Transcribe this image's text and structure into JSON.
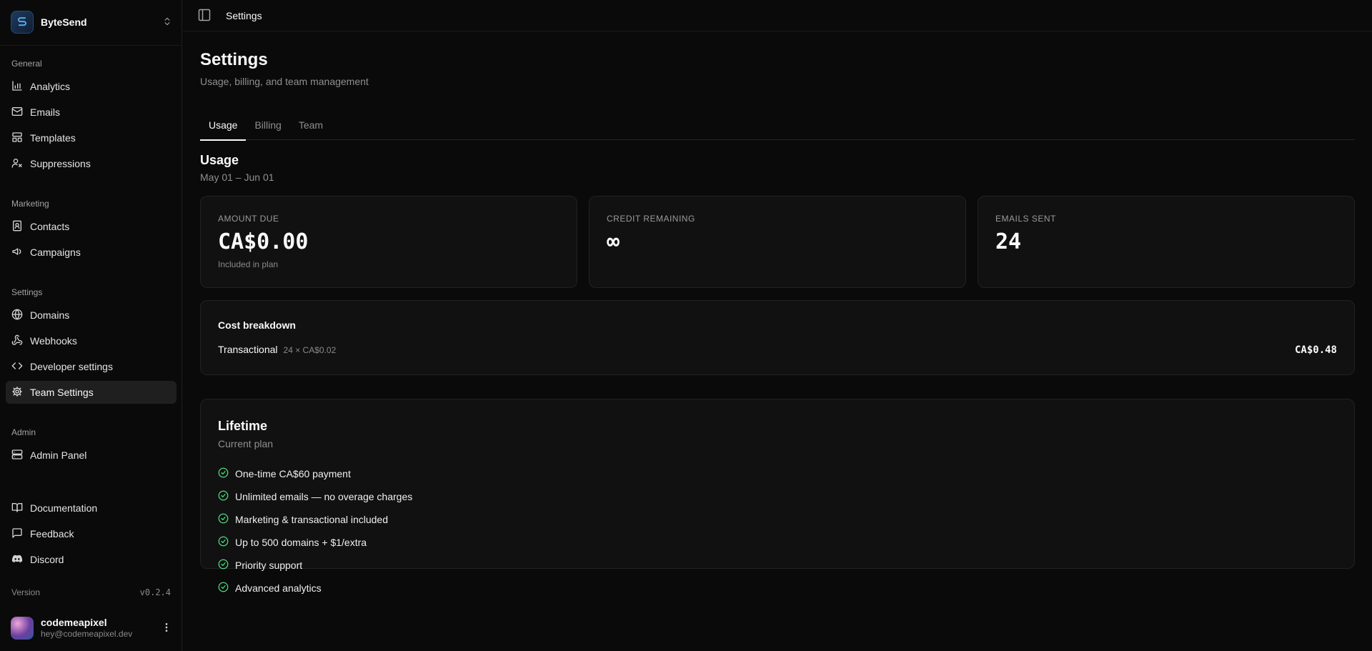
{
  "app": {
    "name": "ByteSend"
  },
  "sidebar": {
    "groups": [
      {
        "label": "General",
        "items": [
          {
            "label": "Analytics",
            "icon": "bar-chart-icon"
          },
          {
            "label": "Emails",
            "icon": "mail-icon"
          },
          {
            "label": "Templates",
            "icon": "layout-icon"
          },
          {
            "label": "Suppressions",
            "icon": "user-x-icon"
          }
        ]
      },
      {
        "label": "Marketing",
        "items": [
          {
            "label": "Contacts",
            "icon": "contact-book-icon"
          },
          {
            "label": "Campaigns",
            "icon": "megaphone-icon"
          }
        ]
      },
      {
        "label": "Settings",
        "items": [
          {
            "label": "Domains",
            "icon": "globe-icon"
          },
          {
            "label": "Webhooks",
            "icon": "webhook-icon"
          },
          {
            "label": "Developer settings",
            "icon": "code-icon"
          },
          {
            "label": "Team Settings",
            "icon": "gear-icon",
            "active": true
          }
        ]
      },
      {
        "label": "Admin",
        "items": [
          {
            "label": "Admin Panel",
            "icon": "server-icon"
          }
        ]
      }
    ],
    "footer_links": [
      {
        "label": "Documentation",
        "icon": "book-icon"
      },
      {
        "label": "Feedback",
        "icon": "message-icon"
      },
      {
        "label": "Discord",
        "icon": "discord-icon"
      }
    ],
    "version_label": "Version",
    "version_value": "v0.2.4",
    "user": {
      "name": "codemeapixel",
      "email": "hey@codemeapixel.dev"
    }
  },
  "topbar": {
    "breadcrumb": "Settings"
  },
  "page": {
    "title": "Settings",
    "subtitle": "Usage, billing, and team management",
    "tabs": [
      {
        "label": "Usage",
        "active": true
      },
      {
        "label": "Billing",
        "active": false
      },
      {
        "label": "Team",
        "active": false
      }
    ]
  },
  "usage": {
    "title": "Usage",
    "period": "May 01 – Jun 01",
    "stats": [
      {
        "label": "AMOUNT DUE",
        "value": "CA$0.00",
        "note": "Included in plan"
      },
      {
        "label": "CREDIT REMAINING",
        "value": "∞",
        "note": ""
      },
      {
        "label": "EMAILS SENT",
        "value": "24",
        "note": ""
      }
    ],
    "cost_breakdown": {
      "title": "Cost breakdown",
      "row_name": "Transactional",
      "row_detail": "24 × CA$0.02",
      "row_amount": "CA$0.48"
    }
  },
  "plan": {
    "title": "Lifetime",
    "subtitle": "Current plan",
    "features": [
      "One-time CA$60 payment",
      "Unlimited emails — no overage charges",
      "Marketing & transactional included",
      "Up to 500 domains + $1/extra",
      "Priority support",
      "Advanced analytics"
    ],
    "check_color": "#4ade80"
  }
}
